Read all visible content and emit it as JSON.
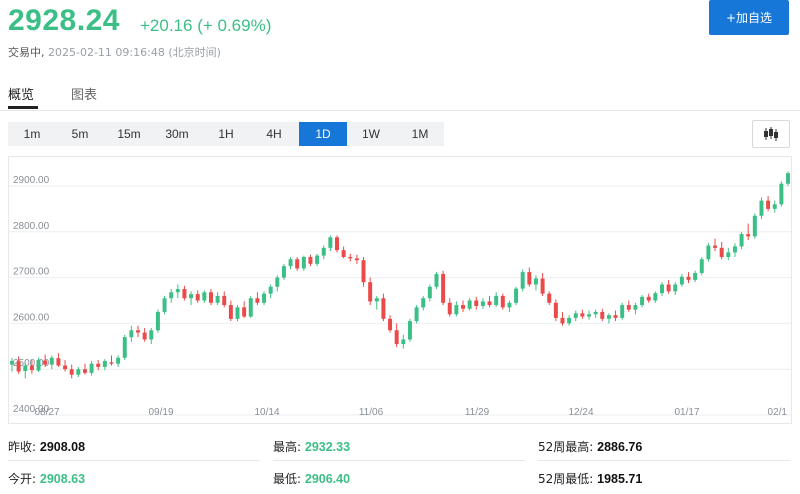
{
  "header": {
    "price": "2928.24",
    "change": "+20.16 (+ 0.69%)",
    "status_label": "交易中,",
    "timestamp": "2025-02-11 09:16:48 (北京时间)",
    "watch_button": "+加自选"
  },
  "tabs": [
    {
      "label": "概览",
      "active": true
    },
    {
      "label": "图表",
      "active": false
    }
  ],
  "periods": [
    "1m",
    "5m",
    "15m",
    "30m",
    "1H",
    "4H",
    "1D",
    "1W",
    "1M"
  ],
  "active_period": "1D",
  "colors": {
    "up": "#3cbf86",
    "down": "#ea4a4a",
    "accent": "#1677d9"
  },
  "icons": {
    "chart_type": "candlestick-icon"
  },
  "chart_data": {
    "type": "candlestick",
    "y_ticks": [
      "2900.00",
      "2800.00",
      "2700.00",
      "2600.00",
      "2500.00",
      "2400.00"
    ],
    "x_ticks": [
      "08/27",
      "09/19",
      "10/14",
      "11/06",
      "11/29",
      "12/24",
      "01/17",
      "02/1"
    ],
    "ylim": [
      2400,
      2935
    ],
    "grid": true,
    "candles": [
      {
        "o": 2510,
        "h": 2525,
        "l": 2495,
        "c": 2518
      },
      {
        "o": 2517,
        "h": 2528,
        "l": 2490,
        "c": 2495
      },
      {
        "o": 2496,
        "h": 2515,
        "l": 2480,
        "c": 2508
      },
      {
        "o": 2508,
        "h": 2520,
        "l": 2490,
        "c": 2498
      },
      {
        "o": 2497,
        "h": 2525,
        "l": 2494,
        "c": 2520
      },
      {
        "o": 2519,
        "h": 2532,
        "l": 2505,
        "c": 2510
      },
      {
        "o": 2510,
        "h": 2530,
        "l": 2500,
        "c": 2525
      },
      {
        "o": 2524,
        "h": 2535,
        "l": 2505,
        "c": 2508
      },
      {
        "o": 2508,
        "h": 2520,
        "l": 2495,
        "c": 2500
      },
      {
        "o": 2500,
        "h": 2510,
        "l": 2480,
        "c": 2488
      },
      {
        "o": 2488,
        "h": 2505,
        "l": 2483,
        "c": 2500
      },
      {
        "o": 2500,
        "h": 2512,
        "l": 2488,
        "c": 2492
      },
      {
        "o": 2492,
        "h": 2518,
        "l": 2486,
        "c": 2512
      },
      {
        "o": 2512,
        "h": 2520,
        "l": 2498,
        "c": 2505
      },
      {
        "o": 2505,
        "h": 2522,
        "l": 2498,
        "c": 2518
      },
      {
        "o": 2515,
        "h": 2530,
        "l": 2508,
        "c": 2512
      },
      {
        "o": 2512,
        "h": 2530,
        "l": 2505,
        "c": 2525
      },
      {
        "o": 2525,
        "h": 2575,
        "l": 2520,
        "c": 2570
      },
      {
        "o": 2570,
        "h": 2595,
        "l": 2560,
        "c": 2585
      },
      {
        "o": 2585,
        "h": 2595,
        "l": 2570,
        "c": 2580
      },
      {
        "o": 2580,
        "h": 2590,
        "l": 2560,
        "c": 2565
      },
      {
        "o": 2565,
        "h": 2590,
        "l": 2555,
        "c": 2585
      },
      {
        "o": 2585,
        "h": 2630,
        "l": 2580,
        "c": 2625
      },
      {
        "o": 2625,
        "h": 2660,
        "l": 2620,
        "c": 2655
      },
      {
        "o": 2655,
        "h": 2675,
        "l": 2645,
        "c": 2668
      },
      {
        "o": 2668,
        "h": 2685,
        "l": 2655,
        "c": 2675
      },
      {
        "o": 2675,
        "h": 2682,
        "l": 2650,
        "c": 2655
      },
      {
        "o": 2655,
        "h": 2670,
        "l": 2640,
        "c": 2664
      },
      {
        "o": 2664,
        "h": 2672,
        "l": 2645,
        "c": 2650
      },
      {
        "o": 2650,
        "h": 2672,
        "l": 2645,
        "c": 2668
      },
      {
        "o": 2668,
        "h": 2675,
        "l": 2640,
        "c": 2645
      },
      {
        "o": 2645,
        "h": 2668,
        "l": 2640,
        "c": 2660
      },
      {
        "o": 2660,
        "h": 2670,
        "l": 2635,
        "c": 2640
      },
      {
        "o": 2640,
        "h": 2650,
        "l": 2605,
        "c": 2610
      },
      {
        "o": 2610,
        "h": 2640,
        "l": 2605,
        "c": 2635
      },
      {
        "o": 2635,
        "h": 2648,
        "l": 2612,
        "c": 2615
      },
      {
        "o": 2615,
        "h": 2660,
        "l": 2612,
        "c": 2655
      },
      {
        "o": 2655,
        "h": 2668,
        "l": 2640,
        "c": 2645
      },
      {
        "o": 2645,
        "h": 2670,
        "l": 2640,
        "c": 2665
      },
      {
        "o": 2665,
        "h": 2685,
        "l": 2655,
        "c": 2680
      },
      {
        "o": 2680,
        "h": 2705,
        "l": 2670,
        "c": 2700
      },
      {
        "o": 2700,
        "h": 2730,
        "l": 2695,
        "c": 2725
      },
      {
        "o": 2725,
        "h": 2745,
        "l": 2718,
        "c": 2740
      },
      {
        "o": 2740,
        "h": 2745,
        "l": 2715,
        "c": 2720
      },
      {
        "o": 2720,
        "h": 2748,
        "l": 2715,
        "c": 2745
      },
      {
        "o": 2745,
        "h": 2750,
        "l": 2725,
        "c": 2730
      },
      {
        "o": 2730,
        "h": 2752,
        "l": 2725,
        "c": 2748
      },
      {
        "o": 2748,
        "h": 2770,
        "l": 2740,
        "c": 2765
      },
      {
        "o": 2765,
        "h": 2792,
        "l": 2758,
        "c": 2788
      },
      {
        "o": 2788,
        "h": 2792,
        "l": 2755,
        "c": 2760
      },
      {
        "o": 2760,
        "h": 2768,
        "l": 2742,
        "c": 2745
      },
      {
        "o": 2745,
        "h": 2752,
        "l": 2735,
        "c": 2742
      },
      {
        "o": 2742,
        "h": 2750,
        "l": 2730,
        "c": 2738
      },
      {
        "o": 2738,
        "h": 2745,
        "l": 2680,
        "c": 2690
      },
      {
        "o": 2690,
        "h": 2700,
        "l": 2640,
        "c": 2648
      },
      {
        "o": 2648,
        "h": 2660,
        "l": 2630,
        "c": 2655
      },
      {
        "o": 2655,
        "h": 2665,
        "l": 2605,
        "c": 2610
      },
      {
        "o": 2610,
        "h": 2618,
        "l": 2580,
        "c": 2585
      },
      {
        "o": 2585,
        "h": 2600,
        "l": 2548,
        "c": 2555
      },
      {
        "o": 2555,
        "h": 2575,
        "l": 2545,
        "c": 2565
      },
      {
        "o": 2565,
        "h": 2610,
        "l": 2560,
        "c": 2605
      },
      {
        "o": 2605,
        "h": 2640,
        "l": 2600,
        "c": 2635
      },
      {
        "o": 2635,
        "h": 2660,
        "l": 2628,
        "c": 2655
      },
      {
        "o": 2655,
        "h": 2685,
        "l": 2648,
        "c": 2680
      },
      {
        "o": 2680,
        "h": 2712,
        "l": 2675,
        "c": 2708
      },
      {
        "o": 2708,
        "h": 2715,
        "l": 2640,
        "c": 2645
      },
      {
        "o": 2645,
        "h": 2655,
        "l": 2615,
        "c": 2620
      },
      {
        "o": 2620,
        "h": 2648,
        "l": 2615,
        "c": 2640
      },
      {
        "o": 2640,
        "h": 2650,
        "l": 2625,
        "c": 2632
      },
      {
        "o": 2632,
        "h": 2655,
        "l": 2628,
        "c": 2650
      },
      {
        "o": 2650,
        "h": 2658,
        "l": 2630,
        "c": 2638
      },
      {
        "o": 2638,
        "h": 2655,
        "l": 2632,
        "c": 2648
      },
      {
        "o": 2648,
        "h": 2660,
        "l": 2635,
        "c": 2640
      },
      {
        "o": 2640,
        "h": 2668,
        "l": 2636,
        "c": 2660
      },
      {
        "o": 2660,
        "h": 2665,
        "l": 2630,
        "c": 2635
      },
      {
        "o": 2635,
        "h": 2650,
        "l": 2625,
        "c": 2645
      },
      {
        "o": 2645,
        "h": 2680,
        "l": 2640,
        "c": 2676
      },
      {
        "o": 2676,
        "h": 2718,
        "l": 2670,
        "c": 2712
      },
      {
        "o": 2712,
        "h": 2722,
        "l": 2680,
        "c": 2685
      },
      {
        "o": 2685,
        "h": 2705,
        "l": 2672,
        "c": 2698
      },
      {
        "o": 2698,
        "h": 2710,
        "l": 2660,
        "c": 2665
      },
      {
        "o": 2665,
        "h": 2670,
        "l": 2640,
        "c": 2645
      },
      {
        "o": 2645,
        "h": 2652,
        "l": 2605,
        "c": 2612
      },
      {
        "o": 2612,
        "h": 2625,
        "l": 2595,
        "c": 2600
      },
      {
        "o": 2600,
        "h": 2618,
        "l": 2595,
        "c": 2612
      },
      {
        "o": 2612,
        "h": 2628,
        "l": 2605,
        "c": 2622
      },
      {
        "o": 2622,
        "h": 2630,
        "l": 2610,
        "c": 2615
      },
      {
        "o": 2615,
        "h": 2628,
        "l": 2608,
        "c": 2620
      },
      {
        "o": 2620,
        "h": 2630,
        "l": 2612,
        "c": 2625
      },
      {
        "o": 2625,
        "h": 2632,
        "l": 2605,
        "c": 2610
      },
      {
        "o": 2610,
        "h": 2622,
        "l": 2600,
        "c": 2618
      },
      {
        "o": 2618,
        "h": 2628,
        "l": 2605,
        "c": 2612
      },
      {
        "o": 2612,
        "h": 2645,
        "l": 2608,
        "c": 2640
      },
      {
        "o": 2640,
        "h": 2650,
        "l": 2625,
        "c": 2630
      },
      {
        "o": 2630,
        "h": 2645,
        "l": 2620,
        "c": 2640
      },
      {
        "o": 2640,
        "h": 2662,
        "l": 2635,
        "c": 2658
      },
      {
        "o": 2658,
        "h": 2665,
        "l": 2645,
        "c": 2650
      },
      {
        "o": 2650,
        "h": 2670,
        "l": 2645,
        "c": 2666
      },
      {
        "o": 2666,
        "h": 2690,
        "l": 2660,
        "c": 2685
      },
      {
        "o": 2685,
        "h": 2695,
        "l": 2665,
        "c": 2670
      },
      {
        "o": 2670,
        "h": 2690,
        "l": 2662,
        "c": 2685
      },
      {
        "o": 2685,
        "h": 2708,
        "l": 2680,
        "c": 2702
      },
      {
        "o": 2702,
        "h": 2712,
        "l": 2688,
        "c": 2695
      },
      {
        "o": 2695,
        "h": 2715,
        "l": 2690,
        "c": 2710
      },
      {
        "o": 2710,
        "h": 2745,
        "l": 2705,
        "c": 2740
      },
      {
        "o": 2740,
        "h": 2775,
        "l": 2735,
        "c": 2770
      },
      {
        "o": 2770,
        "h": 2785,
        "l": 2758,
        "c": 2765
      },
      {
        "o": 2765,
        "h": 2778,
        "l": 2740,
        "c": 2745
      },
      {
        "o": 2745,
        "h": 2765,
        "l": 2738,
        "c": 2755
      },
      {
        "o": 2755,
        "h": 2775,
        "l": 2745,
        "c": 2768
      },
      {
        "o": 2768,
        "h": 2800,
        "l": 2762,
        "c": 2795
      },
      {
        "o": 2795,
        "h": 2818,
        "l": 2782,
        "c": 2790
      },
      {
        "o": 2790,
        "h": 2840,
        "l": 2785,
        "c": 2835
      },
      {
        "o": 2835,
        "h": 2875,
        "l": 2828,
        "c": 2868
      },
      {
        "o": 2868,
        "h": 2878,
        "l": 2845,
        "c": 2850
      },
      {
        "o": 2850,
        "h": 2868,
        "l": 2842,
        "c": 2860
      },
      {
        "o": 2860,
        "h": 2910,
        "l": 2855,
        "c": 2905
      },
      {
        "o": 2905,
        "h": 2932,
        "l": 2900,
        "c": 2928
      }
    ]
  },
  "stats": [
    {
      "label": "昨收:",
      "value": "2908.08",
      "tone": "black"
    },
    {
      "label": "最高:",
      "value": "2932.33",
      "tone": "green"
    },
    {
      "label": "52周最高:",
      "value": "2886.76",
      "tone": "black"
    },
    {
      "label": "今开:",
      "value": "2908.63",
      "tone": "green"
    },
    {
      "label": "最低:",
      "value": "2906.40",
      "tone": "green"
    },
    {
      "label": "52周最低:",
      "value": "1985.71",
      "tone": "black"
    }
  ]
}
